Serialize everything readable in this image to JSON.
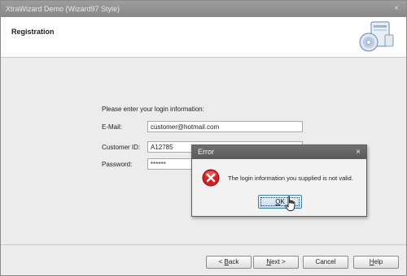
{
  "window": {
    "title": "XtraWizard Demo (Wizard97  Style)",
    "close_glyph": "×"
  },
  "header": {
    "title": "Registration",
    "icon": "computer-cd-icon"
  },
  "form": {
    "prompt": "Please enter your login information:",
    "email_label": "E-Mail:",
    "email_value": "customer@hotmail.com",
    "customer_id_label": "Customer ID:",
    "customer_id_value": "A12785",
    "password_label": "Password:",
    "password_value": "******"
  },
  "footer": {
    "back_prefix": "< ",
    "back_hotkey": "B",
    "back_rest": "ack",
    "next_hotkey": "N",
    "next_rest": "ext >",
    "cancel_label": "Cancel",
    "help_hotkey": "H",
    "help_rest": "elp"
  },
  "dialog": {
    "title": "Error",
    "close_glyph": "×",
    "icon": "error-icon",
    "message": "The login information you supplied is not valid.",
    "ok_hotkey": "O",
    "ok_rest": "K"
  },
  "colors": {
    "error_red": "#d42020",
    "accent_blue": "#3c7fb1"
  }
}
